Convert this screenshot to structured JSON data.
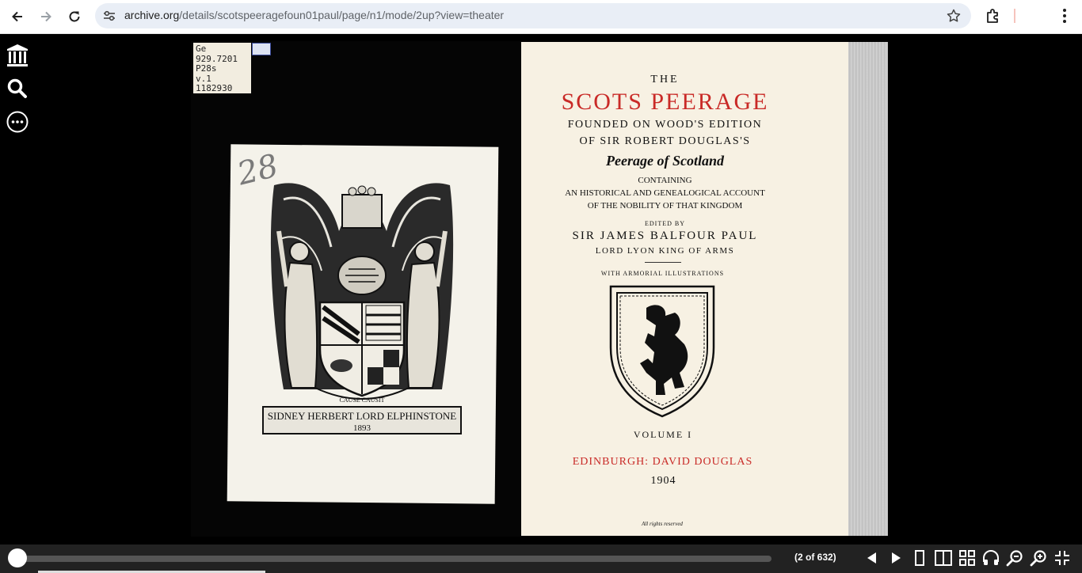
{
  "browser": {
    "url_host": "archive.org",
    "url_path": "/details/scotspeeragefoun01paul/page/n1/mode/2up?view=theater"
  },
  "book": {
    "call_number_lines": [
      "Ge",
      "929.7201",
      "P28s",
      "v.1",
      "1182930"
    ],
    "bookplate_number": "28",
    "bookplate_banner": "SIDNEY HERBERT LORD ELPHINSTONE",
    "bookplate_year": "1893",
    "bookplate_motto": "CAUSE CAUSIT",
    "title_page": {
      "the": "THE",
      "title": "SCOTS PEERAGE",
      "founded": "FOUNDED ON WOOD'S EDITION",
      "of_sir": "OF SIR ROBERT DOUGLAS'S",
      "peerage": "Peerage of Scotland",
      "containing": "CONTAINING",
      "account": "AN HISTORICAL AND GENEALOGICAL ACCOUNT",
      "nobility": "OF THE NOBILITY OF THAT KINGDOM",
      "edited_by": "EDITED BY",
      "editor": "SIR JAMES BALFOUR PAUL",
      "editor_title": "LORD LYON KING OF ARMS",
      "illustrations": "WITH ARMORIAL ILLUSTRATIONS",
      "volume": "VOLUME I",
      "publisher": "EDINBURGH: DAVID DOUGLAS",
      "year": "1904",
      "rights": "All rights reserved"
    }
  },
  "reader": {
    "page_indicator": "(2 of 632)",
    "progress": 0.0
  },
  "icons": {
    "back": "arrow-left-icon",
    "forward": "arrow-right-icon",
    "reload": "reload-icon",
    "site_info": "tune-icon",
    "bookmark": "star-icon",
    "extensions": "puzzle-icon",
    "menu": "kebab-icon",
    "archive": "archive-building-icon",
    "search": "search-icon",
    "more": "more-dots-icon"
  },
  "colors": {
    "title_red": "#c92a27",
    "page_bg": "#f7f1e3",
    "bottom_bar": "#222222"
  }
}
